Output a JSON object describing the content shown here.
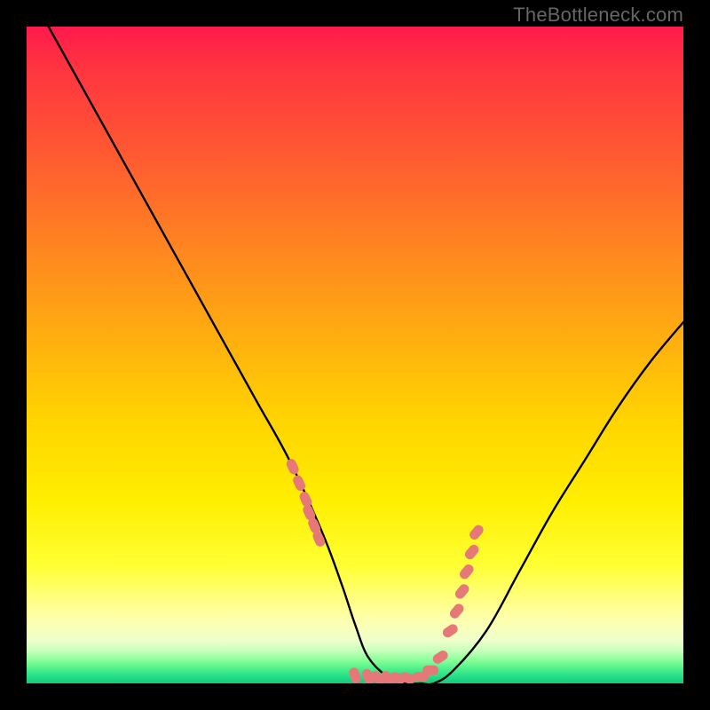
{
  "watermark": "TheBottleneck.com",
  "colors": {
    "curve_stroke": "#000000",
    "marker_fill": "#e77878",
    "marker_stroke": "#d86060",
    "background": "#000000"
  },
  "chart_data": {
    "type": "line",
    "title": "",
    "xlabel": "",
    "ylabel": "",
    "xlim": [
      0,
      100
    ],
    "ylim": [
      0,
      100
    ],
    "grid": false,
    "curve": {
      "x": [
        0,
        5,
        10,
        15,
        20,
        25,
        30,
        35,
        40,
        45,
        48,
        50,
        52,
        55,
        58,
        60,
        62,
        65,
        70,
        75,
        80,
        85,
        90,
        95,
        100
      ],
      "y": [
        106,
        97,
        88,
        79,
        70,
        61,
        52,
        43,
        34,
        23,
        15,
        9,
        4,
        1,
        0,
        0,
        0,
        2,
        8,
        17,
        26,
        34,
        42,
        49,
        55
      ]
    },
    "markers": {
      "x": [
        40.5,
        41.5,
        42.5,
        43.0,
        43.8,
        44.5,
        50.0,
        52.0,
        53.5,
        55.0,
        56.5,
        58.0,
        60.0,
        61.5,
        63.0,
        64.5,
        65.5,
        66.3,
        67.0,
        67.8,
        68.5
      ],
      "y": [
        33.0,
        30.5,
        28.0,
        26.0,
        24.0,
        22.0,
        1.2,
        1.0,
        0.8,
        0.8,
        0.8,
        0.8,
        1.0,
        2.0,
        4.0,
        8.0,
        11.0,
        14.0,
        17.0,
        20.0,
        23.0
      ]
    }
  }
}
